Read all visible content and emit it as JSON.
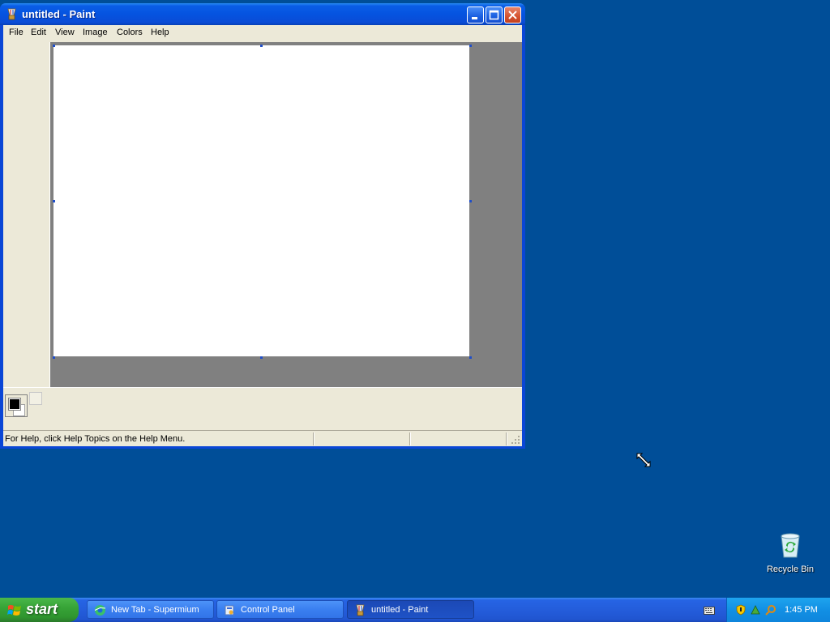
{
  "window": {
    "title": "untitled - Paint"
  },
  "menu": [
    "File",
    "Edit",
    "View",
    "Image",
    "Colors",
    "Help"
  ],
  "status": {
    "help_text": "For Help, click Help Topics on the Help Menu."
  },
  "colors": {
    "foreground": "#000000",
    "background": "#ffffff",
    "desktop": "#004e98"
  },
  "desktop": {
    "recycle_bin_label": "Recycle Bin"
  },
  "taskbar": {
    "start_label": "start",
    "tasks": [
      {
        "label": "New Tab - Supermium",
        "icon": "browser-icon",
        "active": false
      },
      {
        "label": "Control Panel",
        "icon": "control-panel-icon",
        "active": false
      },
      {
        "label": "untitled - Paint",
        "icon": "paint-icon",
        "active": true
      }
    ],
    "clock": "1:45 PM"
  }
}
